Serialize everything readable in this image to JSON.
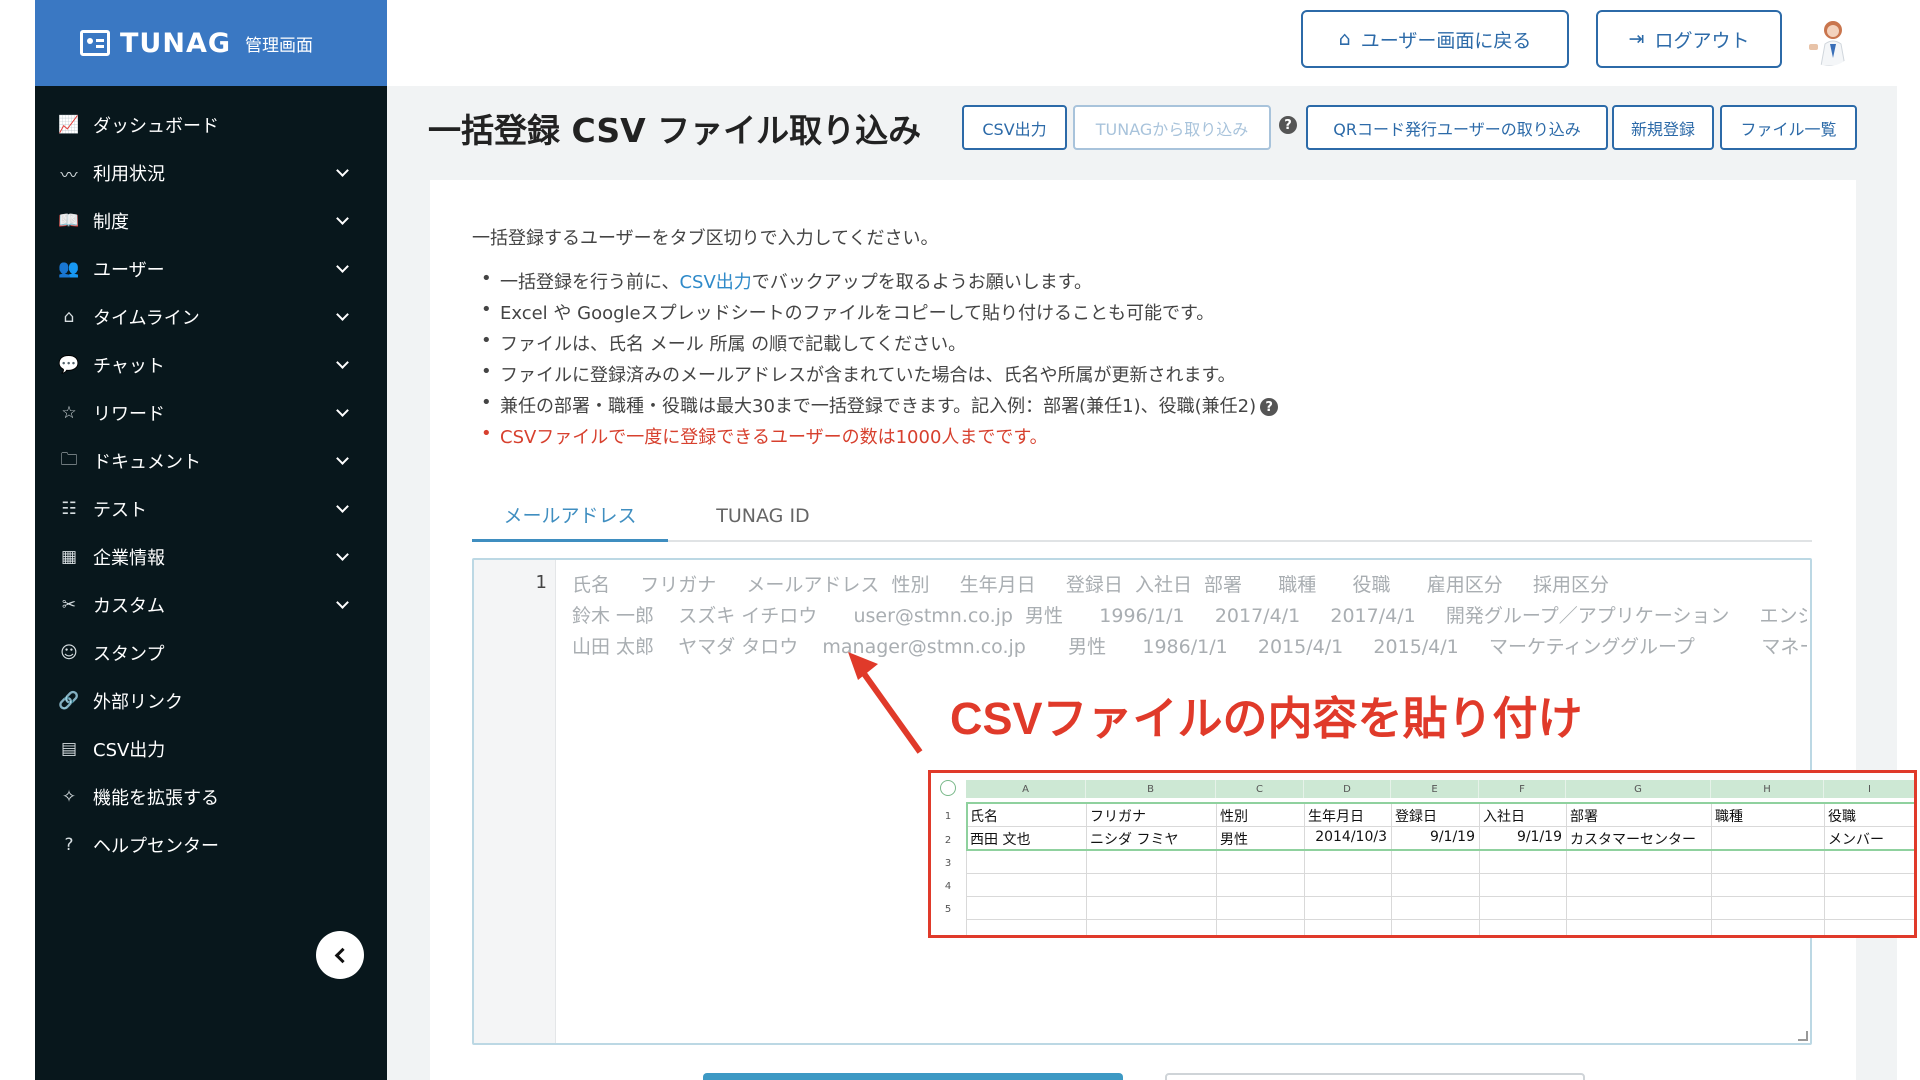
{
  "brand": {
    "name": "TUNAG",
    "sub": "管理画面"
  },
  "sidebar": {
    "items": [
      {
        "label": "ダッシュボード",
        "icon": "chart-icon",
        "glyph": "📈",
        "chevron": false
      },
      {
        "label": "利用状況",
        "icon": "pulse-icon",
        "glyph": "〰",
        "chevron": true
      },
      {
        "label": "制度",
        "icon": "book-icon",
        "glyph": "📖",
        "chevron": true
      },
      {
        "label": "ユーザー",
        "icon": "users-icon",
        "glyph": "👥",
        "chevron": true
      },
      {
        "label": "タイムライン",
        "icon": "home-icon",
        "glyph": "⌂",
        "chevron": true
      },
      {
        "label": "チャット",
        "icon": "chat-icon",
        "glyph": "💬",
        "chevron": true
      },
      {
        "label": "リワード",
        "icon": "star-icon",
        "glyph": "☆",
        "chevron": true
      },
      {
        "label": "ドキュメント",
        "icon": "folder-icon",
        "glyph": "🗀",
        "chevron": true
      },
      {
        "label": "テスト",
        "icon": "checklist-icon",
        "glyph": "☷",
        "chevron": true
      },
      {
        "label": "企業情報",
        "icon": "building-icon",
        "glyph": "▦",
        "chevron": true
      },
      {
        "label": "カスタム",
        "icon": "tools-icon",
        "glyph": "✂",
        "chevron": true
      },
      {
        "label": "スタンプ",
        "icon": "smile-icon",
        "glyph": "☺",
        "chevron": false
      },
      {
        "label": "外部リンク",
        "icon": "link-icon",
        "glyph": "🔗",
        "chevron": false
      },
      {
        "label": "CSV出力",
        "icon": "table-icon",
        "glyph": "▤",
        "chevron": false
      },
      {
        "label": "機能を拡張する",
        "icon": "sparkle-icon",
        "glyph": "✧",
        "chevron": false
      },
      {
        "label": "ヘルプセンター",
        "icon": "question-icon",
        "glyph": "?",
        "chevron": false
      }
    ]
  },
  "header": {
    "back_label": "ユーザー画面に戻る",
    "logout_label": "ログアウト"
  },
  "page": {
    "title": "一括登録 CSV ファイル取り込み",
    "actions": {
      "csv_export": "CSV出力",
      "tunag_import": "TUNAGから取り込み",
      "qr_import": "QRコード発行ユーザーの取り込み",
      "new_register": "新規登録",
      "file_list": "ファイル一覧"
    },
    "intro": "一括登録するユーザーをタブ区切りで入力してください。",
    "bullets": {
      "b1_pre": "一括登録を行う前に、",
      "b1_link": "CSV出力",
      "b1_post": "でバックアップを取るようお願いします。",
      "b2": "Excel や Googleスプレッドシートのファイルをコピーして貼り付けることも可能です。",
      "b3": "ファイルは、氏名 メール 所属 の順で記載してください。",
      "b4": "ファイルに登録済みのメールアドレスが含まれていた場合は、氏名や所属が更新されます。",
      "b5": "兼任の部署・職種・役職は最大30まで一括登録できます。記入例：部署(兼任1)、役職(兼任2)",
      "b6": "CSVファイルで一度に登録できるユーザーの数は1000人までです。"
    },
    "tabs": {
      "email": "メールアドレス",
      "tunag_id": "TUNAG ID"
    },
    "editor": {
      "line_number": "1",
      "placeholder_lines": [
        "氏名     フリガナ     メールアドレス  性別     生年月日     登録日  入社日  部署      職種      役職      雇用区分     採用区分",
        "鈴木 一郎    スズキ イチロウ      user@stmn.co.jp  男性      1996/1/1     2017/4/1     2017/4/1     開発グループ／アプリケーション     エンジニア",
        "山田 太郎    ヤマダ タロウ    manager@stmn.co.jp       男性      1986/1/1     2015/4/1     2015/4/1     マーケティンググループ           マネージャー"
      ]
    },
    "annotation": "CSVファイルの内容を貼り付け"
  },
  "spreadsheet": {
    "columns": [
      "A",
      "B",
      "C",
      "D",
      "E",
      "F",
      "G",
      "H",
      "I"
    ],
    "rows": [
      "1",
      "2",
      "3",
      "4",
      "5"
    ],
    "header_row": [
      "氏名",
      "フリガナ",
      "性別",
      "生年月日",
      "登録日",
      "入社日",
      "部署",
      "職種",
      "役職"
    ],
    "data_row": [
      "西田 文也",
      "ニシダ フミヤ",
      "男性",
      "2014/10/3",
      "9/1/19",
      "9/1/19",
      "カスタマーセンター",
      "",
      "メンバー"
    ]
  },
  "colors": {
    "sidebar_bg": "#08171c",
    "brand_bg": "#3a78c3",
    "accent": "#2c6aa8",
    "tab_active": "#3f8ec0",
    "warning_red": "#d7402e",
    "annotation_red": "#e03a2a"
  }
}
